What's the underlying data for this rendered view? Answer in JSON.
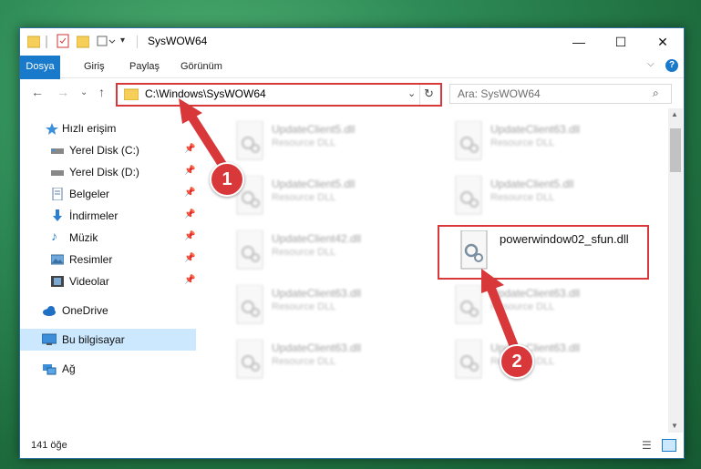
{
  "window": {
    "title": "SysWOW64",
    "minimize": "—",
    "maximize": "☐",
    "close": "✕"
  },
  "ribbon": {
    "tabs": [
      "Dosya",
      "Giriş",
      "Paylaş",
      "Görünüm"
    ]
  },
  "address": {
    "path": "C:\\Windows\\SysWOW64",
    "search_placeholder": "Ara: SysWOW64"
  },
  "sidebar": {
    "items": [
      {
        "label": "Hızlı erişim",
        "icon": "star-icon"
      },
      {
        "label": "Yerel Disk (C:)",
        "icon": "drive-icon"
      },
      {
        "label": "Yerel Disk (D:)",
        "icon": "drive-icon"
      },
      {
        "label": "Belgeler",
        "icon": "documents-icon"
      },
      {
        "label": "İndirmeler",
        "icon": "download-icon"
      },
      {
        "label": "Müzik",
        "icon": "music-icon"
      },
      {
        "label": "Resimler",
        "icon": "pictures-icon"
      },
      {
        "label": "Videolar",
        "icon": "video-icon"
      },
      {
        "label": "OneDrive",
        "icon": "cloud-icon"
      },
      {
        "label": "Bu bilgisayar",
        "icon": "computer-icon"
      },
      {
        "label": "Ağ",
        "icon": "network-icon"
      }
    ]
  },
  "files": [
    {
      "name": "UpdateClient5.dll",
      "type": "Resource DLL"
    },
    {
      "name": "UpdateClient63.dll",
      "type": "Resource DLL"
    },
    {
      "name": "UpdateClient5.dll",
      "type": "Resource DLL"
    },
    {
      "name": "UpdateClient5.dll",
      "type": "Resource DLL"
    },
    {
      "name": "UpdateClient42.dll",
      "type": "Resource DLL"
    },
    {
      "name": "powerwindow02_sfun.dll",
      "type": ""
    },
    {
      "name": "UpdateClient63.dll",
      "type": "Resource DLL"
    },
    {
      "name": "UpdateClient63.dll",
      "type": "Resource DLL"
    },
    {
      "name": "UpdateClient63.dll",
      "type": "Resource DLL"
    },
    {
      "name": "UpdateClient63.dll",
      "type": "Resource DLL"
    }
  ],
  "status": {
    "item_count": "141 öğe"
  },
  "annotations": [
    "1",
    "2"
  ],
  "colors": {
    "accent": "#1979ca",
    "highlight": "#d9383a"
  }
}
